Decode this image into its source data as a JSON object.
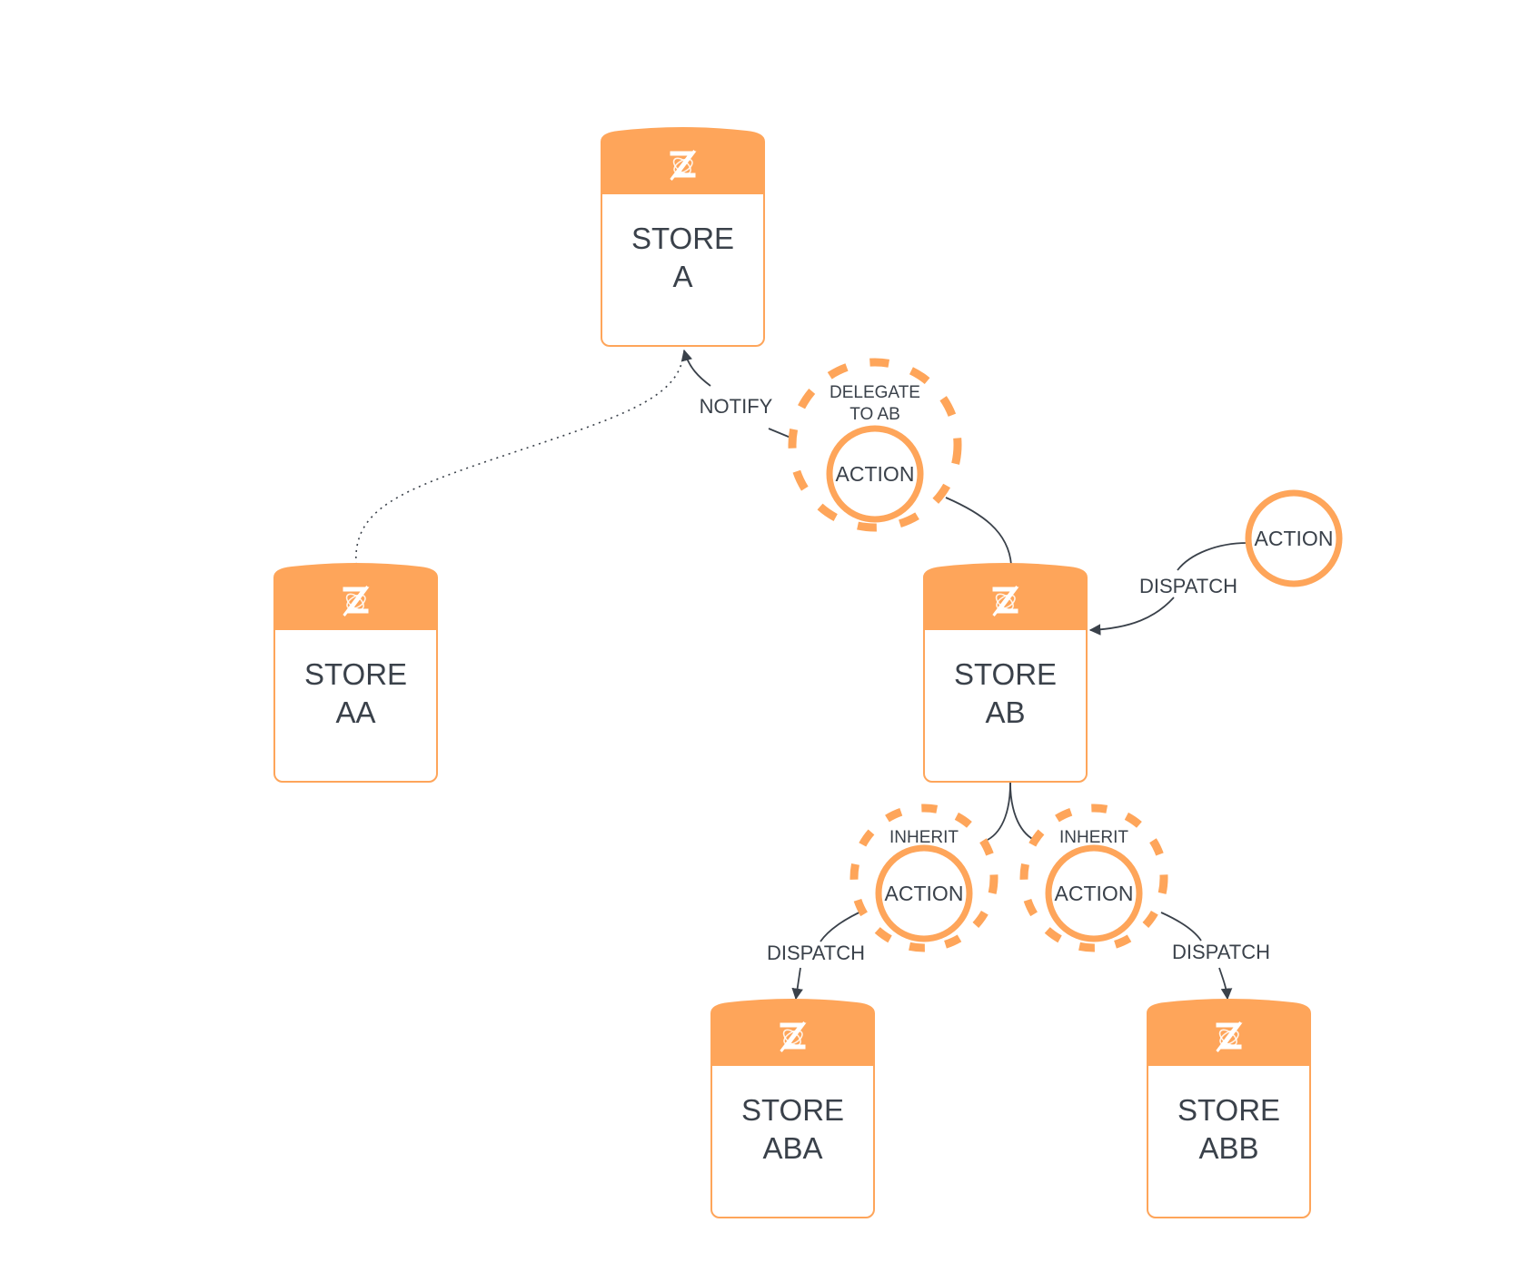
{
  "diagram": {
    "colors": {
      "accent": "#FEA55A",
      "text": "#3A414A",
      "edge": "#3A414A",
      "background": "#FFFFFF"
    },
    "stores": [
      {
        "id": "A",
        "line1": "STORE",
        "line2": "A",
        "icon": "zustand-icon"
      },
      {
        "id": "AA",
        "line1": "STORE",
        "line2": "AA",
        "icon": "zustand-icon"
      },
      {
        "id": "AB",
        "line1": "STORE",
        "line2": "AB",
        "icon": "zustand-icon"
      },
      {
        "id": "ABA",
        "line1": "STORE",
        "line2": "ABA",
        "icon": "zustand-icon"
      },
      {
        "id": "ABB",
        "line1": "STORE",
        "line2": "ABB",
        "icon": "zustand-icon"
      }
    ],
    "actions": [
      {
        "id": "delegate",
        "label": "ACTION",
        "ring": true,
        "ring_line1": "DELEGATE",
        "ring_line2": "TO AB"
      },
      {
        "id": "standalone",
        "label": "ACTION",
        "ring": false
      },
      {
        "id": "inherit_left",
        "label": "ACTION",
        "ring": true,
        "ring_line1": "INHERIT"
      },
      {
        "id": "inherit_right",
        "label": "ACTION",
        "ring": true,
        "ring_line1": "INHERIT"
      }
    ],
    "edges": [
      {
        "id": "notify",
        "from": "delegate",
        "to": "A",
        "label": "NOTIFY",
        "style": "solid",
        "arrow": true
      },
      {
        "id": "aa_to_a",
        "from": "AA",
        "to": "A",
        "label": "",
        "style": "dotted",
        "arrow": false
      },
      {
        "id": "delegate_to_ab",
        "from": "delegate",
        "to": "AB",
        "label": "",
        "style": "solid",
        "arrow": false
      },
      {
        "id": "dispatch_ab",
        "from": "standalone",
        "to": "AB",
        "label": "DISPATCH",
        "style": "solid",
        "arrow": true
      },
      {
        "id": "ab_to_inherit_left",
        "from": "AB",
        "to": "inherit_left",
        "label": "",
        "style": "solid",
        "arrow": false
      },
      {
        "id": "ab_to_inherit_right",
        "from": "AB",
        "to": "inherit_right",
        "label": "",
        "style": "solid",
        "arrow": false
      },
      {
        "id": "dispatch_aba",
        "from": "inherit_left",
        "to": "ABA",
        "label": "DISPATCH",
        "style": "solid",
        "arrow": true
      },
      {
        "id": "dispatch_abb",
        "from": "inherit_right",
        "to": "ABB",
        "label": "DISPATCH",
        "style": "solid",
        "arrow": true
      }
    ]
  }
}
